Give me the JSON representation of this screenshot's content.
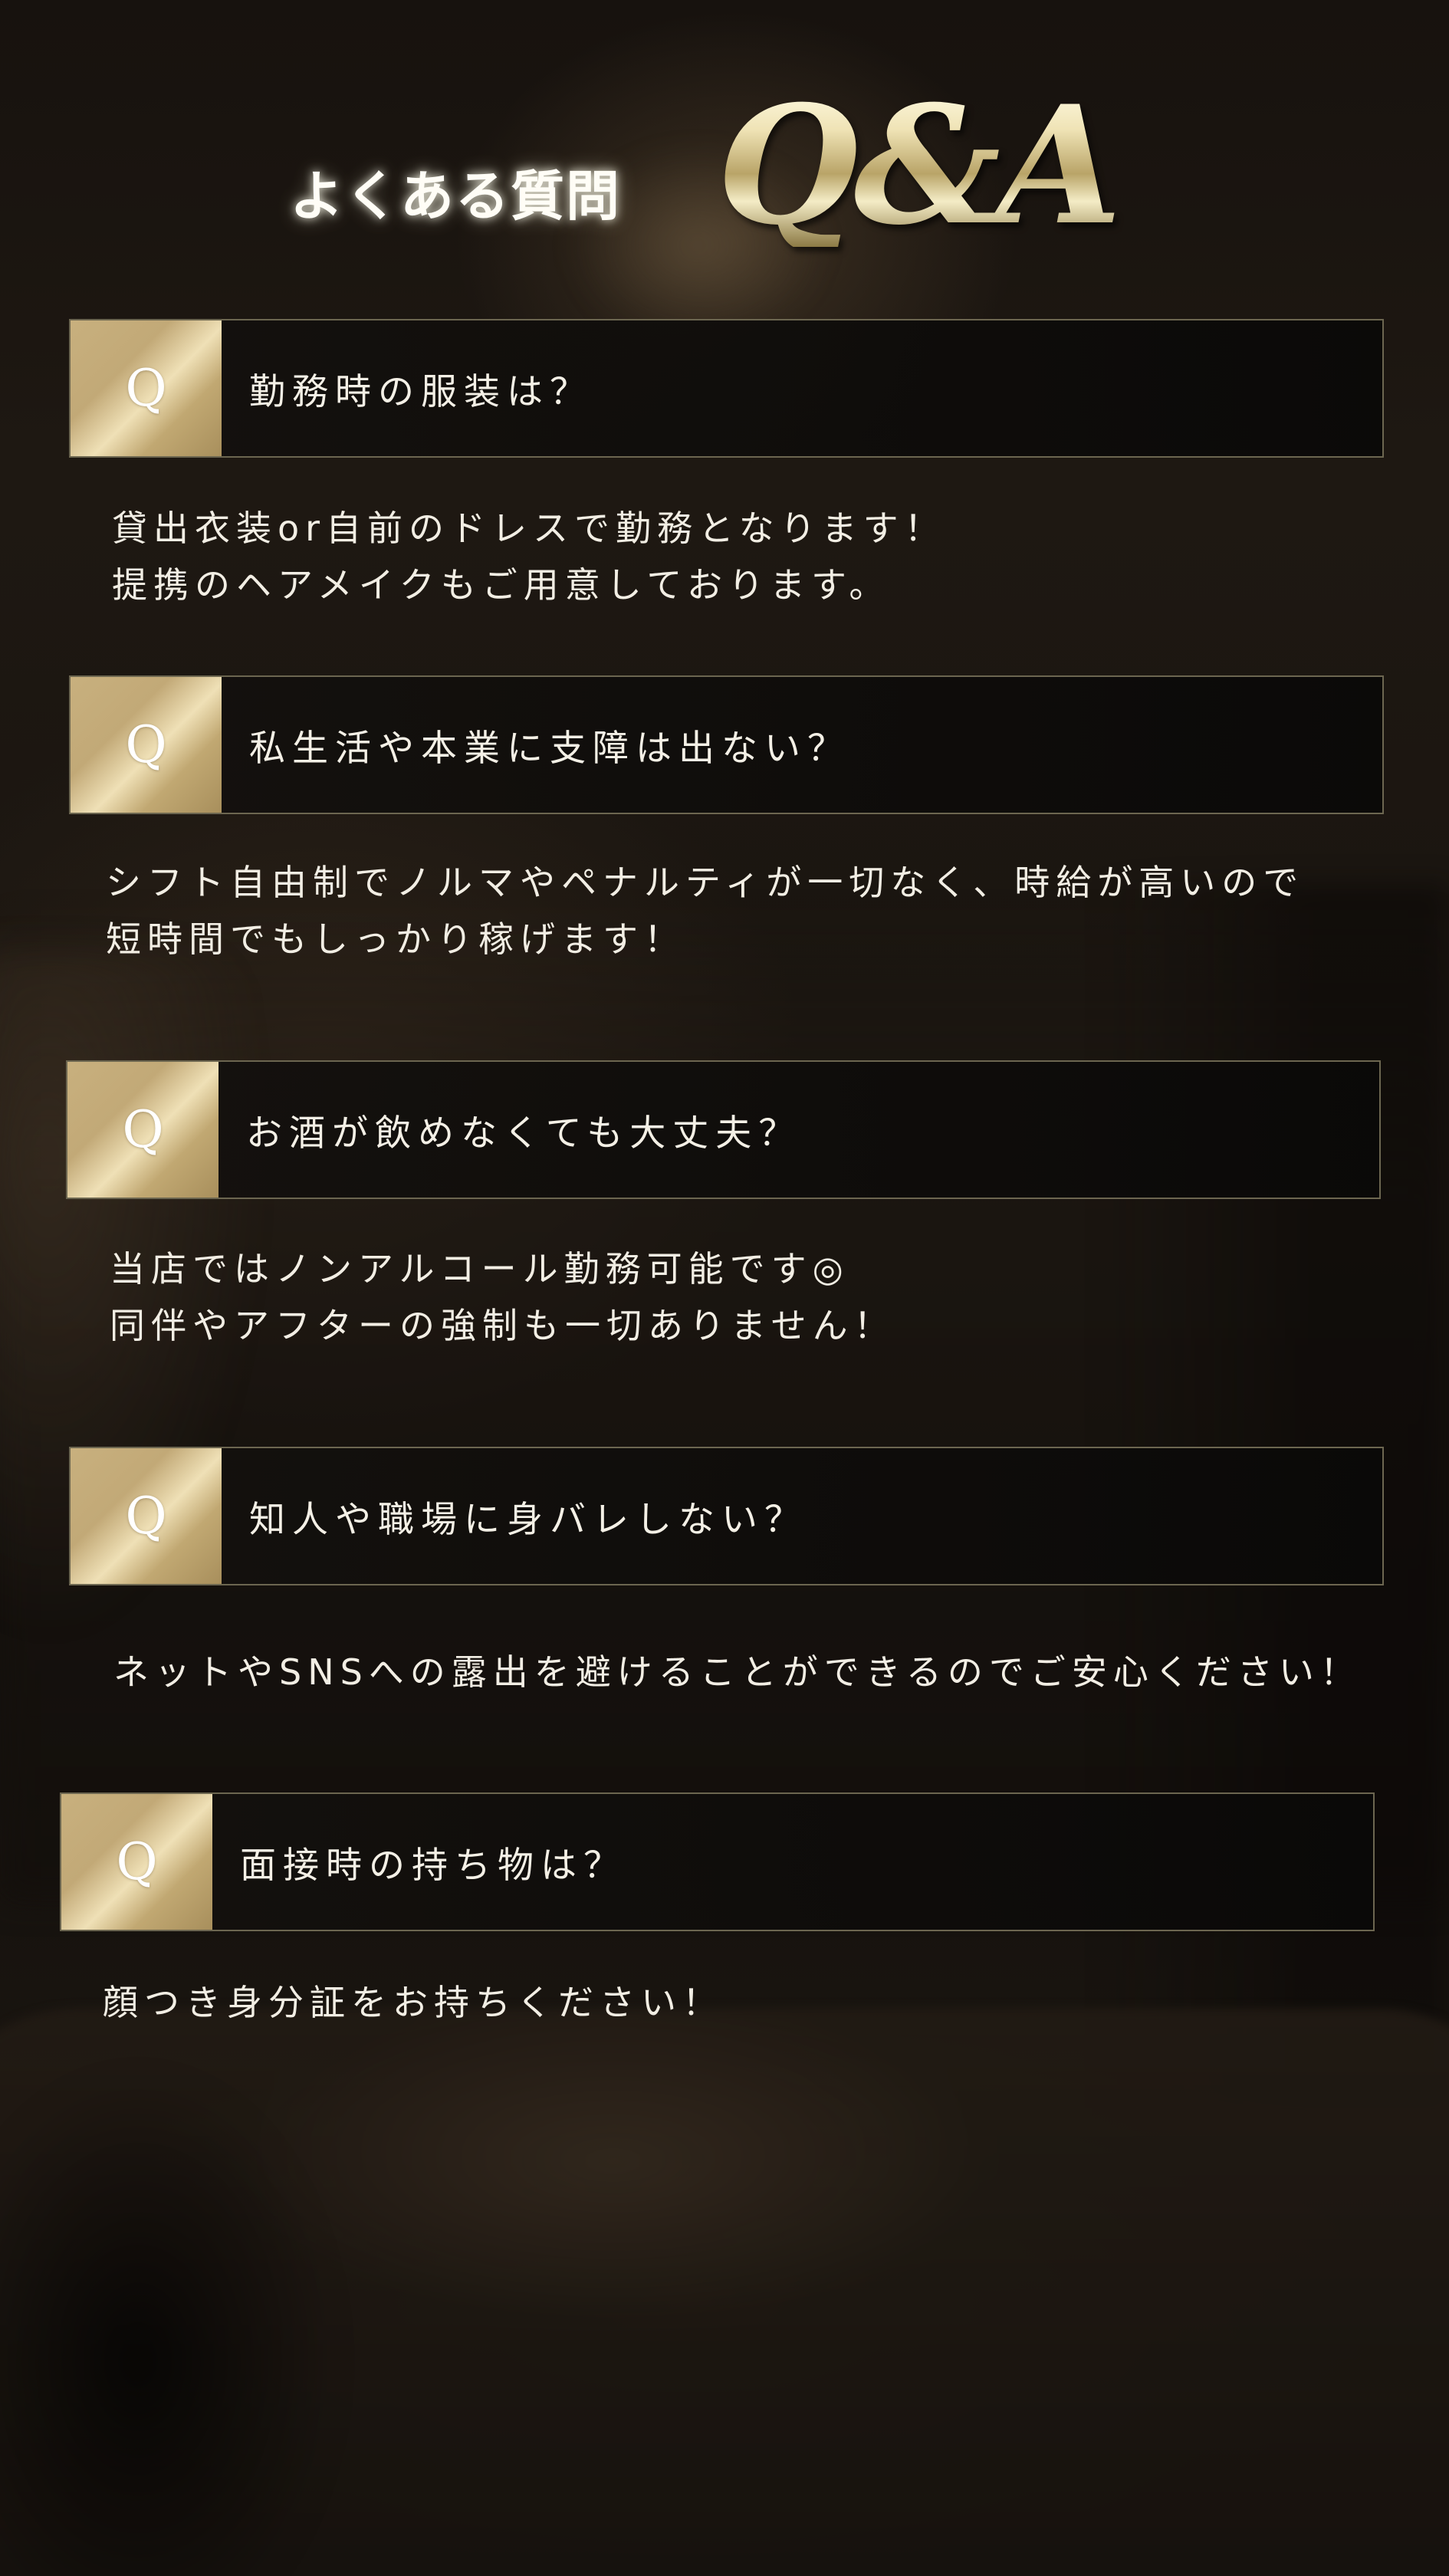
{
  "header": {
    "subtitle": "よくある質問",
    "title": "Q&A"
  },
  "qa": [
    {
      "badge": "Q",
      "question": "勤務時の服装は？",
      "answer": [
        "貸出衣装or自前のドレスで勤務となります！",
        "提携のヘアメイクもご用意しております。"
      ]
    },
    {
      "badge": "Q",
      "question": "私生活や本業に支障は出ない？",
      "answer": [
        "シフト自由制でノルマやペナルティが一切なく、時給が高いので",
        "短時間でもしっかり稼げます！"
      ]
    },
    {
      "badge": "Q",
      "question": "お酒が飲めなくても大丈夫？",
      "answer": [
        "当店ではノンアルコール勤務可能です◎",
        "同伴やアフターの強制も一切ありません！"
      ]
    },
    {
      "badge": "Q",
      "question": "知人や職場に身バレしない？",
      "answer": [
        "ネットやSNSへの露出を避けることができるのでご安心ください！"
      ]
    },
    {
      "badge": "Q",
      "question": "面接時の持ち物は？",
      "answer": [
        "顔つき身分証をお持ちください！"
      ]
    }
  ]
}
